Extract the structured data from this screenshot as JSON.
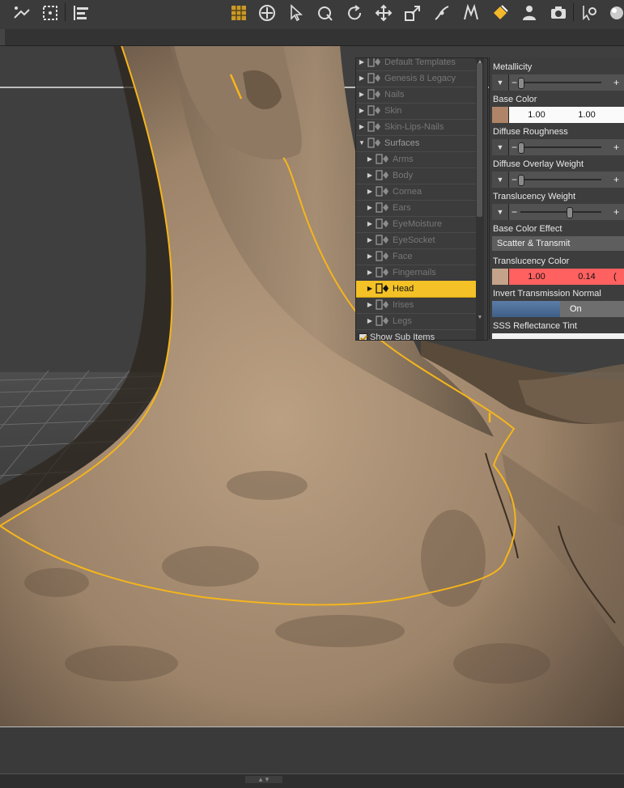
{
  "colors": {
    "accent": "#f4c227",
    "skin_light": "#bfa37f",
    "skin_dark": "#6b5946",
    "translucency_red": "#ff5c5c",
    "selection_outline": "#f5b51c"
  },
  "toolbar": {
    "left_icons": [
      "node-select-icon",
      "region-select-icon",
      "align-icon"
    ],
    "right_icons": [
      "grid-toggle-icon",
      "universal-tool-icon",
      "pointer-tool-icon",
      "orbit-tool-icon",
      "rotate-tool-icon",
      "translate-tool-icon",
      "scale-tool-icon",
      "joint-editor-icon",
      "geometry-editor-icon",
      "surface-selection-icon",
      "figure-icon",
      "camera-icon",
      "settings-icon",
      "render-icon"
    ],
    "active_icon": "surface-selection-icon"
  },
  "tree": {
    "items": [
      {
        "label": "Default Templates",
        "indent": 0,
        "expanded": false,
        "selected": false
      },
      {
        "label": "Genesis 8 Legacy",
        "indent": 0,
        "expanded": false,
        "selected": false
      },
      {
        "label": "Nails",
        "indent": 0,
        "expanded": false,
        "selected": false
      },
      {
        "label": "Skin",
        "indent": 0,
        "expanded": false,
        "selected": false
      },
      {
        "label": "Skin-Lips-Nails",
        "indent": 0,
        "expanded": false,
        "selected": false
      },
      {
        "label": "Surfaces",
        "indent": 0,
        "expanded": true,
        "selected": false
      },
      {
        "label": "Arms",
        "indent": 1,
        "expanded": false,
        "selected": false
      },
      {
        "label": "Body",
        "indent": 1,
        "expanded": false,
        "selected": false
      },
      {
        "label": "Cornea",
        "indent": 1,
        "expanded": false,
        "selected": false
      },
      {
        "label": "Ears",
        "indent": 1,
        "expanded": false,
        "selected": false
      },
      {
        "label": "EyeMoisture",
        "indent": 1,
        "expanded": false,
        "selected": false
      },
      {
        "label": "EyeSocket",
        "indent": 1,
        "expanded": false,
        "selected": false
      },
      {
        "label": "Face",
        "indent": 1,
        "expanded": false,
        "selected": false
      },
      {
        "label": "Fingernails",
        "indent": 1,
        "expanded": false,
        "selected": false
      },
      {
        "label": "Head",
        "indent": 1,
        "expanded": false,
        "selected": true
      },
      {
        "label": "Irises",
        "indent": 1,
        "expanded": false,
        "selected": false
      },
      {
        "label": "Legs",
        "indent": 1,
        "expanded": false,
        "selected": false
      }
    ],
    "show_sub_items": {
      "label": "Show Sub Items",
      "checked": true
    }
  },
  "properties": {
    "metallicity": {
      "label": "Metallicity",
      "value": 0.0
    },
    "base_color": {
      "label": "Base Color",
      "r": "1.00",
      "g": "1.00"
    },
    "diffuse_roughness": {
      "label": "Diffuse Roughness",
      "value": 0.0
    },
    "diffuse_overlay_weight": {
      "label": "Diffuse Overlay Weight",
      "value": 0.0
    },
    "translucency_weight": {
      "label": "Translucency Weight",
      "value": 0.6
    },
    "base_color_effect": {
      "label": "Base Color Effect",
      "value": "Scatter & Transmit"
    },
    "translucency_color": {
      "label": "Translucency Color",
      "r": "1.00",
      "g": "0.14",
      "b_partial": "("
    },
    "invert_transmission_normal": {
      "label": "Invert Transmission Normal",
      "value": "On"
    },
    "sss_reflectance_tint": {
      "label": "SSS Reflectance Tint"
    }
  }
}
